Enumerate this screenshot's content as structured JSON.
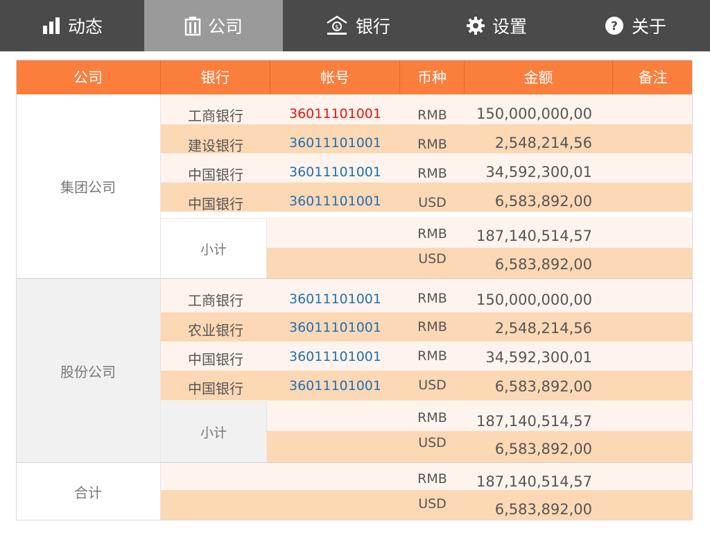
{
  "nav": {
    "tabs": [
      {
        "label": "动态",
        "icon": "bar-chart-icon",
        "active": false
      },
      {
        "label": "公司",
        "icon": "building-icon",
        "active": true
      },
      {
        "label": "银行",
        "icon": "bank-icon",
        "active": false
      },
      {
        "label": "设置",
        "icon": "gear-icon",
        "active": false
      },
      {
        "label": "关于",
        "icon": "help-icon",
        "active": false
      }
    ]
  },
  "table": {
    "headers": [
      "公司",
      "银行",
      "帐号",
      "币种",
      "金额",
      "备注"
    ],
    "groups": [
      {
        "company": "集团公司",
        "rows": [
          {
            "bank": "工商银行",
            "account": "36011101001",
            "currency": "RMB",
            "amount": "150,000,000,00",
            "highlight": true
          },
          {
            "bank": "建设银行",
            "account": "36011101001",
            "currency": "RMB",
            "amount": "2,548,214,56",
            "highlight": false
          },
          {
            "bank": "中国银行",
            "account": "36011101001",
            "currency": "RMB",
            "amount": "34,592,300,01",
            "highlight": false
          },
          {
            "bank": "中国银行",
            "account": "36011101001",
            "currency": "USD",
            "amount": "6,583,892,00",
            "highlight": false
          }
        ],
        "subtotal_label": "小计",
        "subtotal": [
          {
            "currency": "RMB",
            "amount": "187,140,514,57"
          },
          {
            "currency": "USD",
            "amount": "6,583,892,00"
          }
        ]
      },
      {
        "company": "股份公司",
        "rows": [
          {
            "bank": "工商银行",
            "account": "36011101001",
            "currency": "RMB",
            "amount": "150,000,000,00",
            "highlight": false
          },
          {
            "bank": "农业银行",
            "account": "36011101001",
            "currency": "RMB",
            "amount": "2,548,214,56",
            "highlight": false
          },
          {
            "bank": "中国银行",
            "account": "36011101001",
            "currency": "RMB",
            "amount": "34,592,300,01",
            "highlight": false
          },
          {
            "bank": "中国银行",
            "account": "36011101001",
            "currency": "USD",
            "amount": "6,583,892,00",
            "highlight": false
          }
        ],
        "subtotal_label": "小计",
        "subtotal": [
          {
            "currency": "RMB",
            "amount": "187,140,514,57"
          },
          {
            "currency": "USD",
            "amount": "6,583,892,00"
          }
        ]
      }
    ],
    "total_label": "合计",
    "total": [
      {
        "currency": "RMB",
        "amount": "187,140,514,57"
      },
      {
        "currency": "USD",
        "amount": "6,583,892,00"
      }
    ]
  },
  "colors": {
    "nav_bg": "#4a4a4a",
    "nav_active": "#9a9a9a",
    "header_orange": "#fb7e3c",
    "row_light": "#fef4ed",
    "row_dark": "#fdd8b5",
    "group_gray": "#f1f1f1",
    "account_blue": "#1e6fb5",
    "account_red": "#ee1111"
  }
}
